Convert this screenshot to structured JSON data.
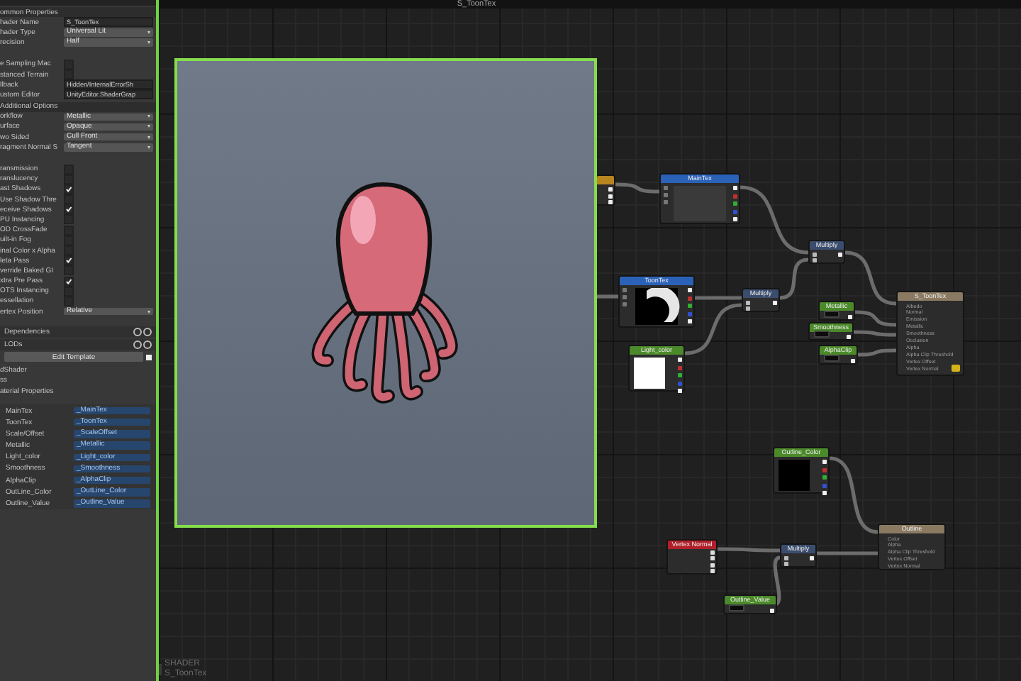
{
  "window": {
    "title": "S_ToonTex"
  },
  "inspector": {
    "rows": [
      {
        "kind": "header",
        "label": "ommon Properties"
      },
      {
        "kind": "text",
        "label": "hader Name",
        "value": "S_ToonTex"
      },
      {
        "kind": "dropdown",
        "label": "hader Type",
        "value": "Universal Lit"
      },
      {
        "kind": "dropdown",
        "label": "recision",
        "value": "Half"
      },
      {
        "kind": "checkbox",
        "label": "e Sampling Mac",
        "checked": false
      },
      {
        "kind": "checkbox",
        "label": "stanced Terrain",
        "checked": false
      },
      {
        "kind": "text",
        "label": "llback",
        "value": "Hidden/InternalErrorSh"
      },
      {
        "kind": "text",
        "label": "ustom Editor",
        "value": "UnityEditor.ShaderGrap"
      },
      {
        "kind": "header",
        "label": "Additional Options"
      },
      {
        "kind": "dropdown",
        "label": "orkflow",
        "value": "Metallic"
      },
      {
        "kind": "dropdown",
        "label": "urface",
        "value": "Opaque"
      },
      {
        "kind": "dropdown",
        "label": "wo Sided",
        "value": "Cull Front"
      },
      {
        "kind": "dropdown",
        "label": "ragment Normal S",
        "value": "Tangent"
      },
      {
        "kind": "checkbox",
        "label": "ransmission",
        "checked": false
      },
      {
        "kind": "checkbox",
        "label": "ranslucency",
        "checked": false
      },
      {
        "kind": "checkbox",
        "label": "ast Shadows",
        "checked": true
      },
      {
        "kind": "checkbox",
        "label": "Use Shadow Thre",
        "checked": false
      },
      {
        "kind": "checkbox",
        "label": "eceive Shadows",
        "checked": true
      },
      {
        "kind": "checkbox",
        "label": "PU Instancing",
        "checked": false
      },
      {
        "kind": "checkbox",
        "label": "OD CrossFade",
        "checked": false
      },
      {
        "kind": "checkbox",
        "label": "uilt-in Fog",
        "checked": false
      },
      {
        "kind": "checkbox",
        "label": "inal Color x Alpha",
        "checked": false
      },
      {
        "kind": "checkbox",
        "label": "leta Pass",
        "checked": true
      },
      {
        "kind": "checkbox",
        "label": "verride Baked GI",
        "checked": false
      },
      {
        "kind": "checkbox",
        "label": "xtra Pre Pass",
        "checked": true
      },
      {
        "kind": "checkbox",
        "label": "OTS Instancing",
        "checked": false
      },
      {
        "kind": "checkbox",
        "label": "essellation",
        "checked": false
      },
      {
        "kind": "dropdown",
        "label": "ertex Position",
        "value": "Relative"
      },
      {
        "kind": "foldout",
        "label": "Dependencies"
      },
      {
        "kind": "foldout",
        "label": "LODs"
      },
      {
        "kind": "button",
        "label": "Edit Template"
      },
      {
        "kind": "plain",
        "label": "dShader"
      },
      {
        "kind": "plain",
        "label": "ss"
      },
      {
        "kind": "plain",
        "label": "aterial Properties"
      },
      {
        "kind": "property",
        "label": "MainTex",
        "value": "_MainTex"
      },
      {
        "kind": "property",
        "label": "ToonTex",
        "value": "_ToonTex"
      },
      {
        "kind": "property",
        "label": "Scale/Offset",
        "value": "_ScaleOffset"
      },
      {
        "kind": "property",
        "label": "Metallic",
        "value": "_Metallic"
      },
      {
        "kind": "property",
        "label": "Light_color",
        "value": "_Light_color"
      },
      {
        "kind": "property",
        "label": "Smoothness",
        "value": "_Smoothness"
      },
      {
        "kind": "property",
        "label": "AlphaClip",
        "value": "_AlphaClip"
      },
      {
        "kind": "property",
        "label": "OutLine_Color",
        "value": "_OutLine_Color"
      },
      {
        "kind": "property",
        "label": "Outline_Value",
        "value": "_Outline_Value"
      }
    ]
  },
  "graph": {
    "nodes": [
      {
        "kind": "small",
        "color": "#b8861e"
      },
      {
        "kind": "texture",
        "title": "MainTex",
        "color": "#2a62b8"
      },
      {
        "kind": "operator",
        "title": "Multiply",
        "color": "#3b4d6e"
      },
      {
        "kind": "ramp",
        "title": "ToonTex",
        "color": "#2a62b8"
      },
      {
        "kind": "operator",
        "title": "Multiply",
        "color": "#3b4d6e"
      },
      {
        "kind": "color",
        "title": "Light_color",
        "color": "#4b8a2a"
      },
      {
        "kind": "float",
        "title": "Metallic",
        "color": "#4b8a2a"
      },
      {
        "kind": "float",
        "title": "Smoothness",
        "color": "#4b8a2a"
      },
      {
        "kind": "float",
        "title": "AlphaClip",
        "color": "#4b8a2a"
      },
      {
        "kind": "master",
        "title": "S_ToonTex",
        "color": "#8a7a62",
        "ports": [
          "Albedo",
          "Normal",
          "Emission",
          "Metallic",
          "Smoothness",
          "Occlusion",
          "Alpha",
          "Alpha Clip Threshold",
          "Vertex Offset",
          "Vertex Normal"
        ]
      },
      {
        "kind": "color",
        "title": "Outline_Color",
        "color": "#4b8a2a"
      },
      {
        "kind": "master",
        "title": "Outline",
        "color": "#8a7a62",
        "ports": [
          "Color",
          "Alpha",
          "Alpha Clip Threshold",
          "Vertex Offset",
          "Vertex Normal"
        ]
      },
      {
        "kind": "input",
        "title": "Vertex Normal",
        "color": "#b0202a"
      },
      {
        "kind": "operator",
        "title": "Multiply",
        "color": "#3b4d6e"
      },
      {
        "kind": "float",
        "title": "Outline_Value",
        "color": "#4b8a2a"
      }
    ],
    "label": {
      "title": "SHADER",
      "subtitle": "S_ToonTex"
    }
  }
}
